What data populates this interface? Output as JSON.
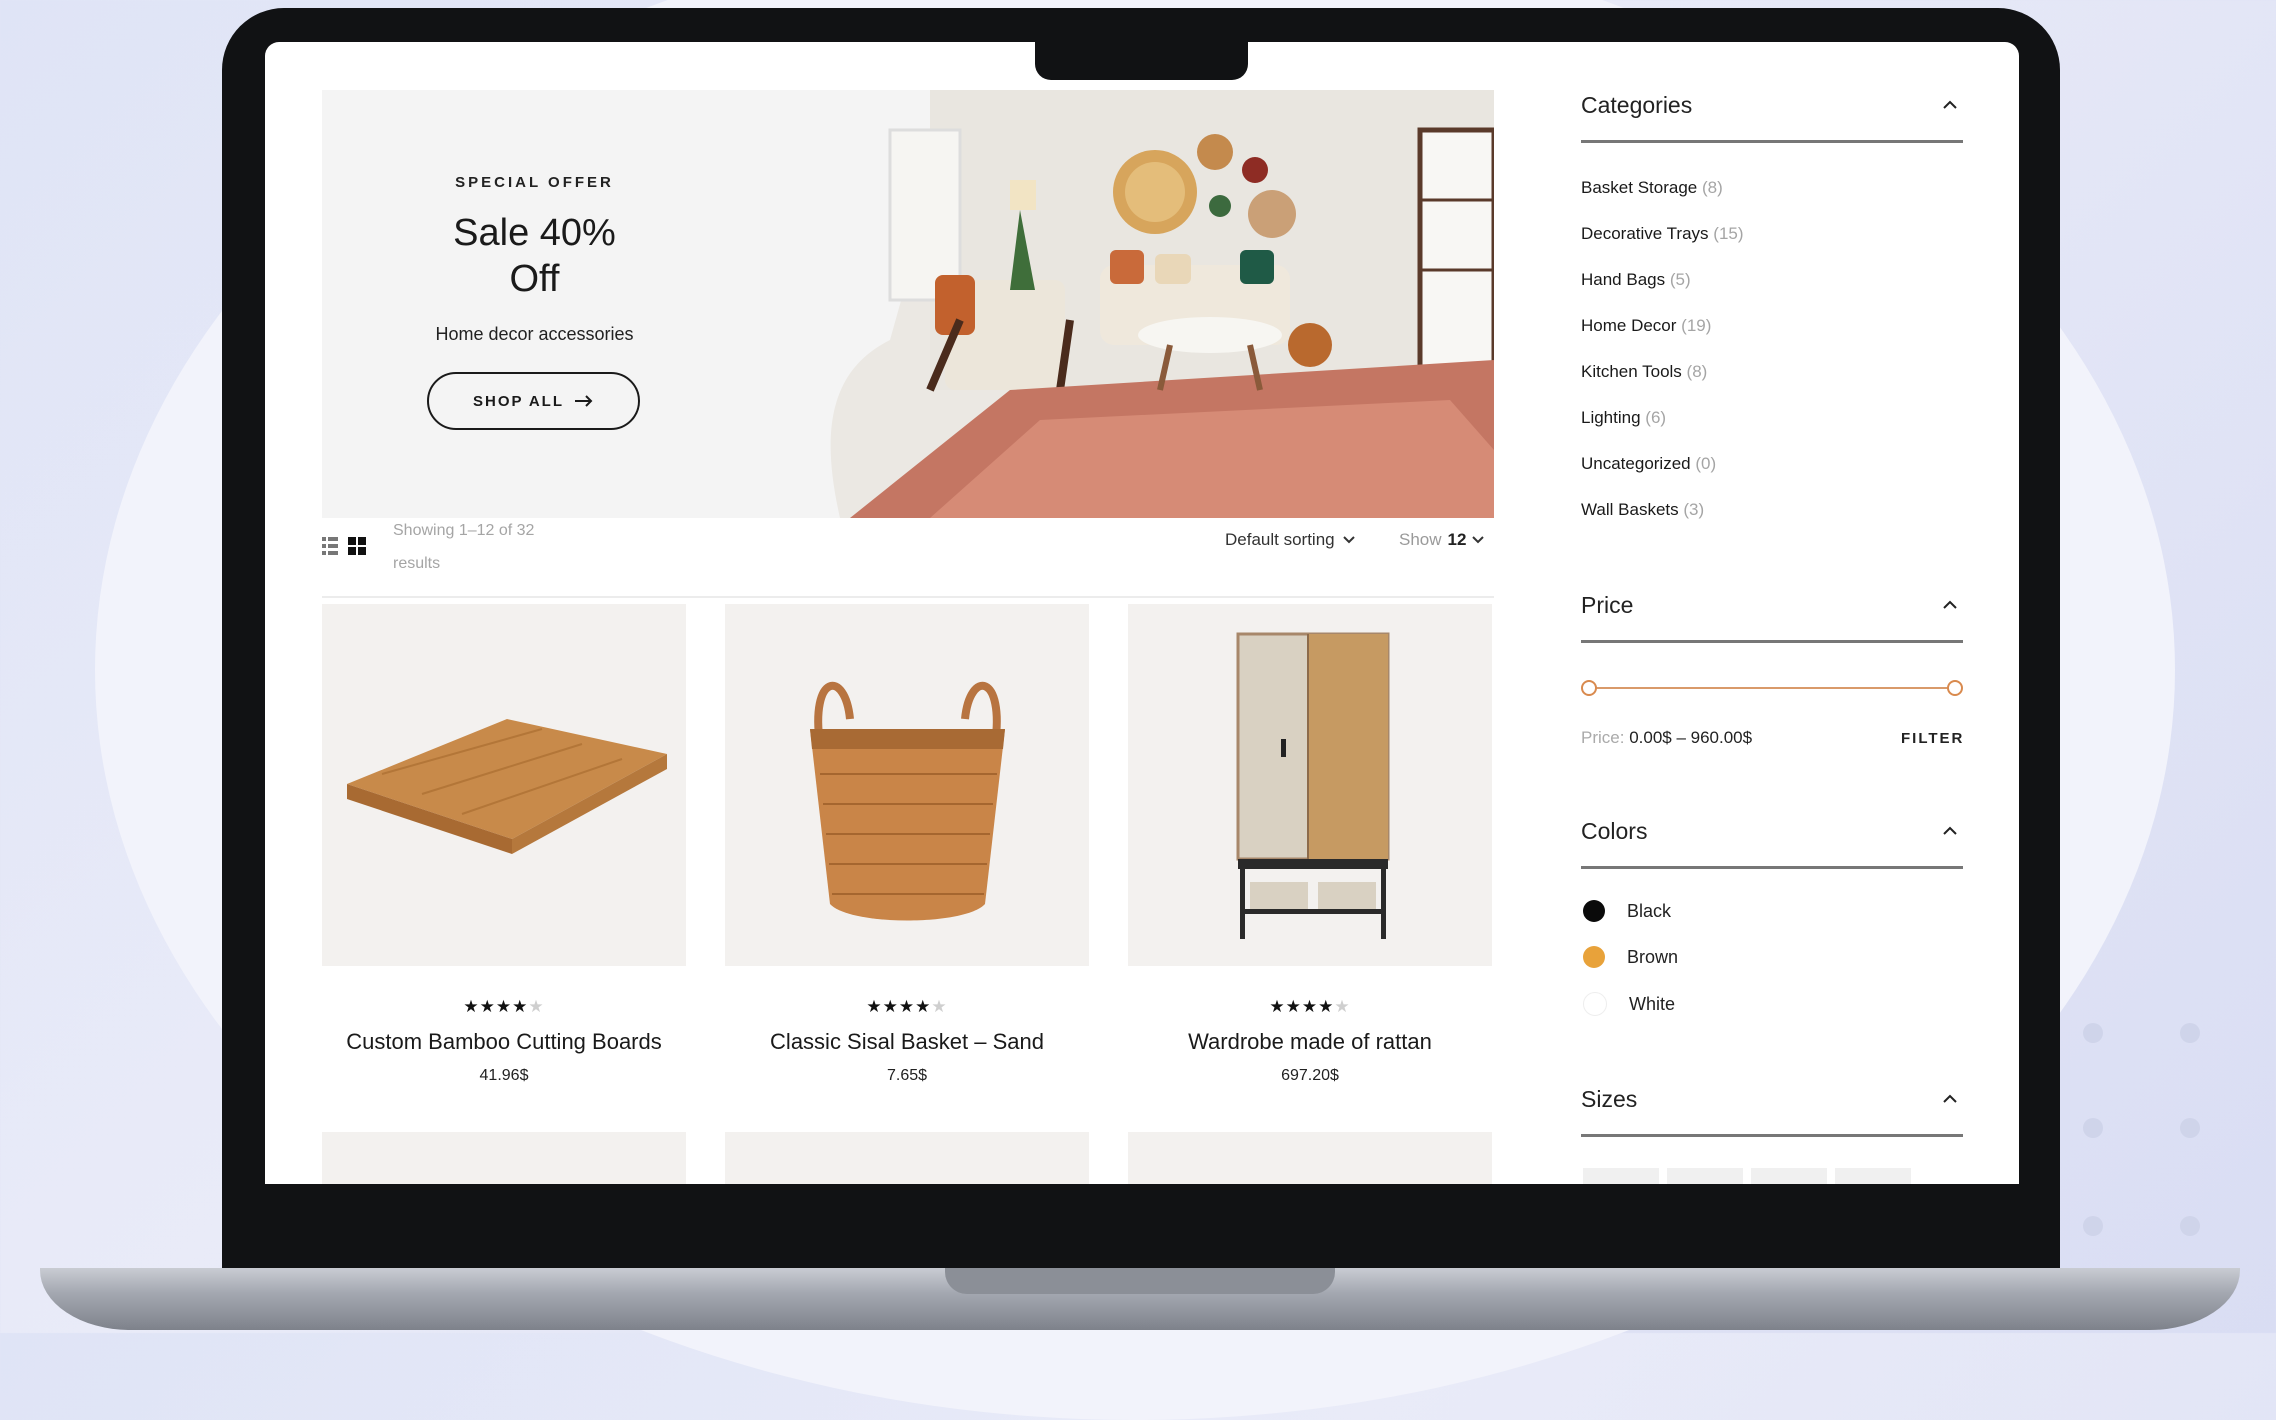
{
  "hero": {
    "label": "SPECIAL OFFER",
    "title": "Sale 40% Off",
    "subtitle": "Home decor accessories",
    "button": "SHOP ALL"
  },
  "toolbar": {
    "showing": "Showing 1–12 of 32 results",
    "sorting": "Default sorting",
    "show_label": "Show",
    "show_value": "12",
    "view_modes": [
      "list-view-icon",
      "grid-view-icon"
    ]
  },
  "products": [
    {
      "name": "Custom Bamboo Cutting Boards",
      "price": "41.96$",
      "rating": 4,
      "stars_full": "★★★★",
      "stars_empty": "★"
    },
    {
      "name": "Classic Sisal Basket – Sand",
      "price": "7.65$",
      "rating": 4,
      "stars_full": "★★★★",
      "stars_empty": "★"
    },
    {
      "name": "Wardrobe made of rattan",
      "price": "697.20$",
      "rating": 4,
      "stars_full": "★★★★",
      "stars_empty": "★"
    }
  ],
  "sidebar": {
    "categories_title": "Categories",
    "categories": [
      {
        "name": "Basket Storage",
        "count": "(8)"
      },
      {
        "name": "Decorative Trays",
        "count": "(15)"
      },
      {
        "name": "Hand Bags",
        "count": "(5)"
      },
      {
        "name": "Home Decor",
        "count": "(19)"
      },
      {
        "name": "Kitchen Tools",
        "count": "(8)"
      },
      {
        "name": "Lighting",
        "count": "(6)"
      },
      {
        "name": "Uncategorized",
        "count": "(0)"
      },
      {
        "name": "Wall Baskets",
        "count": "(3)"
      }
    ],
    "price_title": "Price",
    "price_label": "Price:",
    "price_range": "0.00$ – 960.00$",
    "price_min": 0,
    "price_max": 960,
    "filter_button": "FILTER",
    "colors_title": "Colors",
    "colors": [
      {
        "name": "Black",
        "hex": "#0a0a0a"
      },
      {
        "name": "Brown",
        "hex": "#e8a23a"
      },
      {
        "name": "White",
        "hex": "#ffffff"
      }
    ],
    "sizes_title": "Sizes"
  },
  "accent_color": "#d98a4e"
}
